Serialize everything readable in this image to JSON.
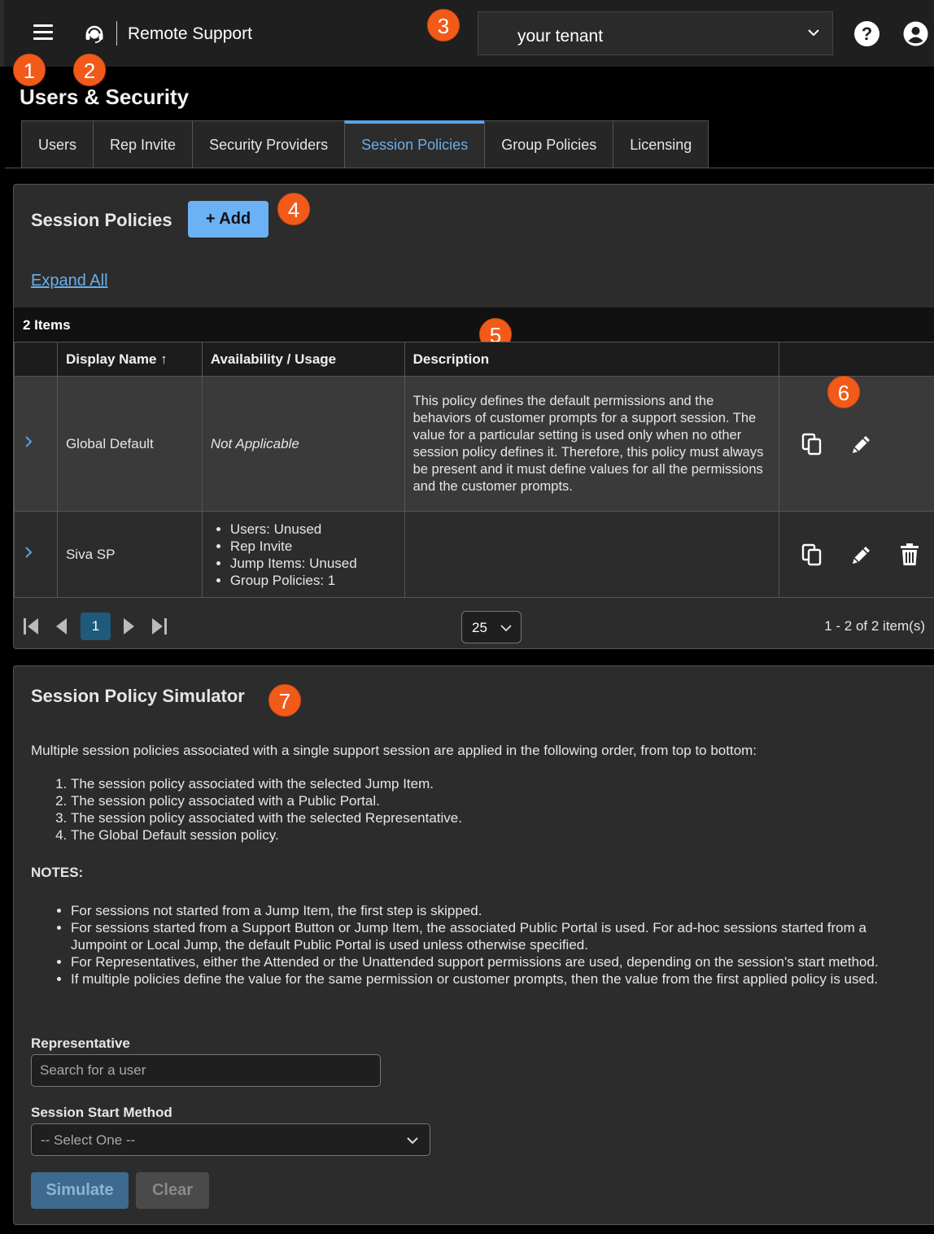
{
  "header": {
    "app_title": "Remote Support",
    "tenant": "your tenant",
    "help_glyph": "?"
  },
  "badges": [
    "1",
    "2",
    "3",
    "4",
    "5",
    "6",
    "7"
  ],
  "page": {
    "title": "Users & Security",
    "tabs": [
      {
        "label": "Users",
        "active": false
      },
      {
        "label": "Rep Invite",
        "active": false
      },
      {
        "label": "Security Providers",
        "active": false
      },
      {
        "label": "Session Policies",
        "active": true
      },
      {
        "label": "Group Policies",
        "active": false
      },
      {
        "label": "Licensing",
        "active": false
      }
    ]
  },
  "policies": {
    "title": "Session Policies",
    "add_label": "+ Add",
    "expand_all": "Expand All",
    "items_count": "2 Items",
    "columns": [
      "Display Name ↑",
      "Availability / Usage",
      "Description"
    ],
    "rows": [
      {
        "name": "Global Default",
        "availability": "Not Applicable",
        "description": "This policy defines the default permissions and the behaviors of customer prompts for a support session. The value for a particular setting is used only when no other session policy defines it. Therefore, this policy must always be present and it must define values for all the permissions and the customer prompts."
      },
      {
        "name": "Siva SP",
        "usage": [
          "Users: Unused",
          "Rep Invite",
          "Jump Items: Unused",
          "Group Policies: 1"
        ],
        "description": ""
      }
    ],
    "pager": {
      "current_page": "1",
      "page_size": "25",
      "info": "1 - 2 of 2 item(s)"
    }
  },
  "simulator": {
    "title": "Session Policy Simulator",
    "intro": "Multiple session policies associated with a single support session are applied in the following order, from top to bottom:",
    "steps": [
      "The session policy associated with the selected Jump Item.",
      "The session policy associated with a Public Portal.",
      "The session policy associated with the selected Representative.",
      "The Global Default session policy."
    ],
    "notes_heading": "NOTES:",
    "notes": [
      "For sessions not started from a Jump Item, the first step is skipped.",
      "For sessions started from a Support Button or Jump Item, the associated Public Portal is used. For ad-hoc sessions started from a Jumpoint or Local Jump, the default Public Portal is used unless otherwise specified.",
      "For Representatives, either the Attended or the Unattended support permissions are used, depending on the session's start method.",
      "If multiple policies define the value for the same permission or customer prompts, then the value from the first applied policy is used."
    ],
    "rep_label": "Representative",
    "rep_placeholder": "Search for a user",
    "method_label": "Session Start Method",
    "method_value": "-- Select One --",
    "simulate_label": "Simulate",
    "clear_label": "Clear"
  }
}
